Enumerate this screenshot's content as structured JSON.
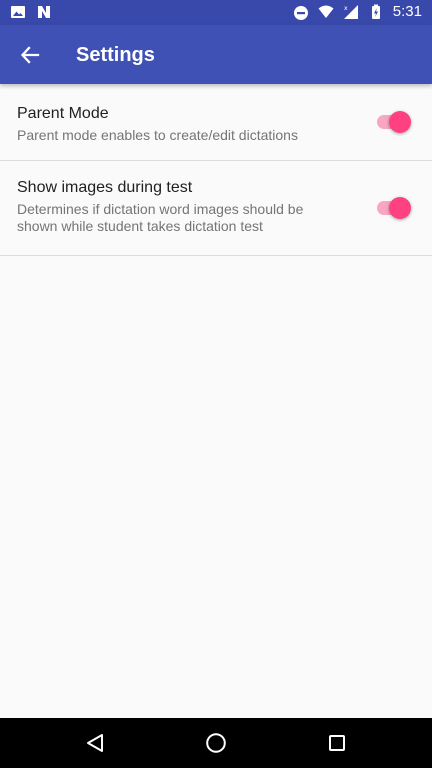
{
  "status_bar": {
    "time": "5:31",
    "left_icons": [
      "image-icon",
      "n-notification-icon"
    ],
    "right_icons": [
      "do-not-disturb-icon",
      "wifi-icon",
      "signal-icon",
      "battery-icon"
    ]
  },
  "app_bar": {
    "title": "Settings",
    "back_icon": "arrow-back-icon",
    "color": "#3f51b5"
  },
  "preferences": [
    {
      "title": "Parent Mode",
      "summary": "Parent mode enables to create/edit dictations",
      "enabled": true
    },
    {
      "title": "Show images during test",
      "summary": "Determines if dictation word images should be shown while student takes dictation test",
      "enabled": true
    }
  ],
  "nav_bar": {
    "icons": [
      "back-triangle-icon",
      "home-circle-icon",
      "recents-square-icon"
    ]
  },
  "colors": {
    "status_bar": "#3949ab",
    "accent": "#ff4081"
  }
}
